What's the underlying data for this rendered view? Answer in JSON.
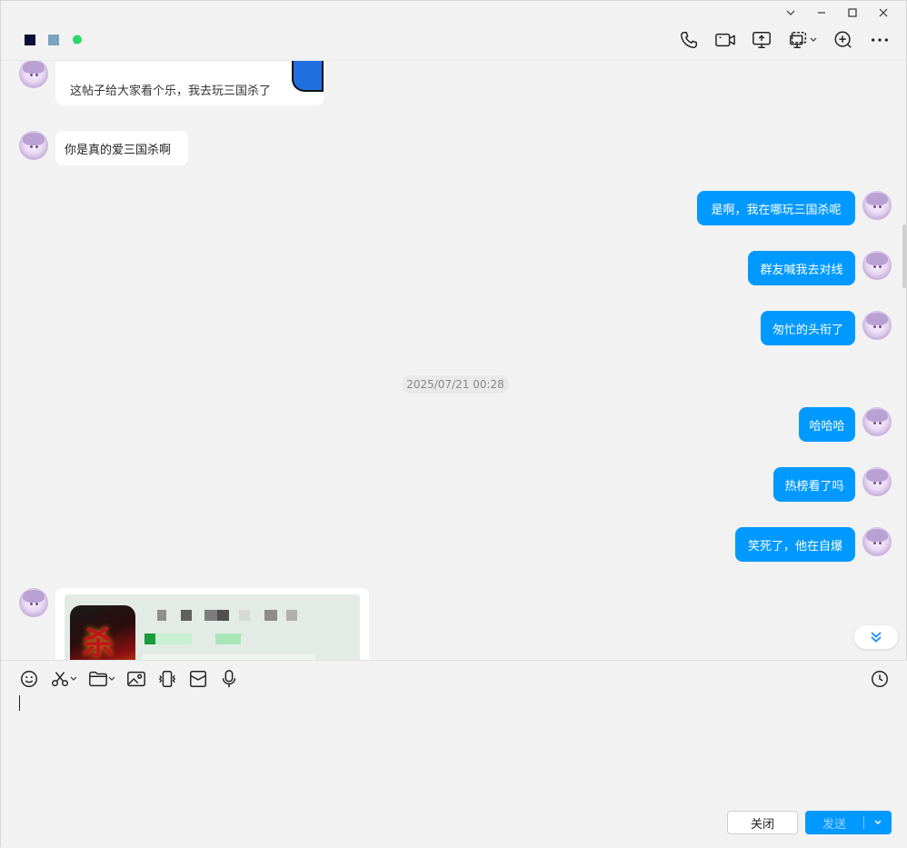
{
  "window": {
    "controls": [
      "collapse",
      "minimize",
      "maximize",
      "close"
    ]
  },
  "header": {
    "tools": [
      "phone-icon",
      "video-icon",
      "screen-share-icon",
      "remote-desktop-icon",
      "add-member-icon",
      "more-icon"
    ]
  },
  "messages": {
    "post_text": "这帖子给大家看个乐，我去玩三国杀了",
    "incoming_1": "你是真的爱三国杀啊",
    "outgoing_1": "是啊，我在哪玩三国杀呢",
    "outgoing_2": "群友喊我去对线",
    "outgoing_3": "匆忙的头衔了",
    "timestamp": "2025/07/21 00:28",
    "outgoing_4": "哈哈哈",
    "outgoing_5": "热榜看了吗",
    "outgoing_6": "笑死了，他在自爆",
    "card_icon_glyph": "杀"
  },
  "colors": {
    "accent": "#0099ff",
    "bubble_in": "#ffffff",
    "background": "#f2f2f2"
  },
  "input": {
    "tools": [
      "emoji-icon",
      "scissors-icon",
      "folder-icon",
      "image-icon",
      "shake-icon",
      "red-packet-icon",
      "microphone-icon",
      "history-icon"
    ],
    "close_label": "关闭",
    "send_label": "发送"
  }
}
